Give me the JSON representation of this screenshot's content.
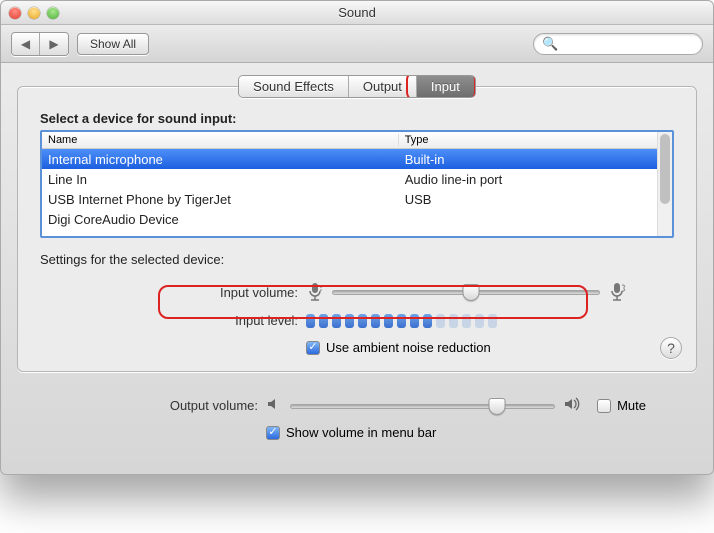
{
  "window": {
    "title": "Sound"
  },
  "toolbar": {
    "back_icon": "◀",
    "fwd_icon": "▶",
    "show_all_label": "Show All",
    "search_placeholder": ""
  },
  "tabs": {
    "items": [
      {
        "label": "Sound Effects",
        "selected": false
      },
      {
        "label": "Output",
        "selected": false
      },
      {
        "label": "Input",
        "selected": true
      }
    ]
  },
  "device_section": {
    "heading": "Select a device for sound input:",
    "cols": {
      "name": "Name",
      "type": "Type"
    },
    "rows": [
      {
        "name": "Internal microphone",
        "type": "Built-in",
        "selected": true
      },
      {
        "name": "Line In",
        "type": "Audio line-in port",
        "selected": false
      },
      {
        "name": "USB Internet Phone by TigerJet",
        "type": "USB",
        "selected": false
      },
      {
        "name": "Digi CoreAudio Device",
        "type": "",
        "selected": false
      }
    ]
  },
  "settings": {
    "heading": "Settings for the selected device:",
    "input_volume_label": "Input volume:",
    "input_volume_percent": 52,
    "input_level_label": "Input level:",
    "input_level_segments_on": 10,
    "input_level_segments_total": 15,
    "ambient_label": "Use ambient noise reduction",
    "ambient_checked": true
  },
  "output": {
    "label": "Output volume:",
    "percent": 78,
    "mute_label": "Mute",
    "mute_checked": false,
    "menubar_label": "Show volume in menu bar",
    "menubar_checked": true
  },
  "help": {
    "glyph": "?"
  },
  "icons": {
    "search": "🔍",
    "check": "✓"
  }
}
